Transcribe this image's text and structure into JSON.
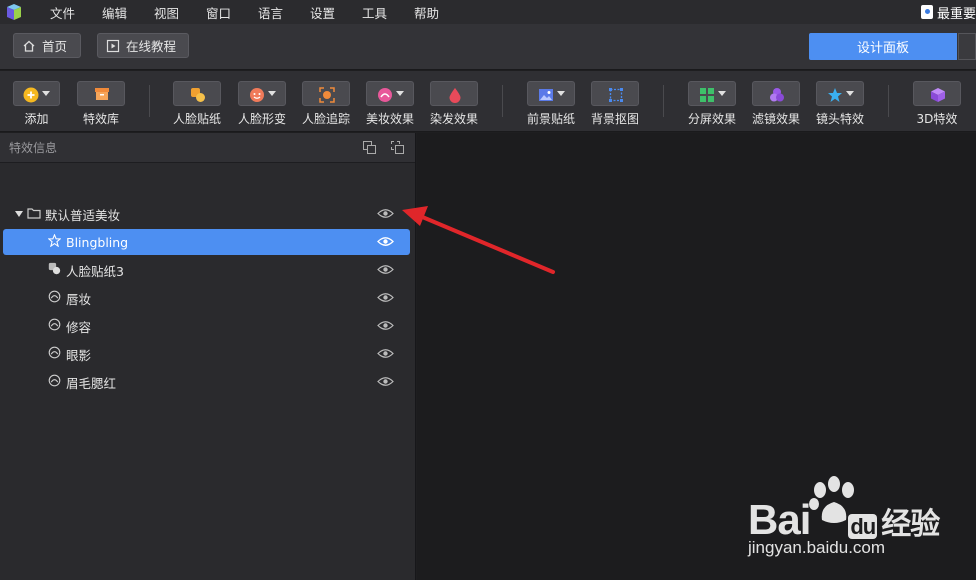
{
  "menu": {
    "items": [
      "文件",
      "编辑",
      "视图",
      "窗口",
      "语言",
      "设置",
      "工具",
      "帮助"
    ],
    "right_label": "最重要"
  },
  "nav": {
    "home_label": "首页",
    "tutorial_label": "在线教程",
    "design_panel_label": "设计面板"
  },
  "toolbar": {
    "add": "添加",
    "effects_lib": "特效库",
    "face_sticker": "人脸贴纸",
    "face_morph": "人脸形变",
    "face_track": "人脸追踪",
    "makeup": "美妆效果",
    "hair_dye": "染发效果",
    "fg_sticker": "前景贴纸",
    "bg_matting": "背景抠图",
    "split_screen": "分屏效果",
    "filter": "滤镜效果",
    "lens": "镜头特效",
    "three_d": "3D特效"
  },
  "panel": {
    "header": "特效信息",
    "tree": {
      "root": "默认普适美妆",
      "items": [
        "Blingbling",
        "人脸贴纸3",
        "唇妆",
        "修容",
        "眼影",
        "眉毛腮红"
      ]
    }
  },
  "watermark": {
    "brand": "Bai",
    "brand_suffix": "du",
    "brand_cn": "经验",
    "url": "jingyan.baidu.com"
  },
  "colors": {
    "accent": "#4d8ff2",
    "annotation_arrow": "#e0262a"
  }
}
